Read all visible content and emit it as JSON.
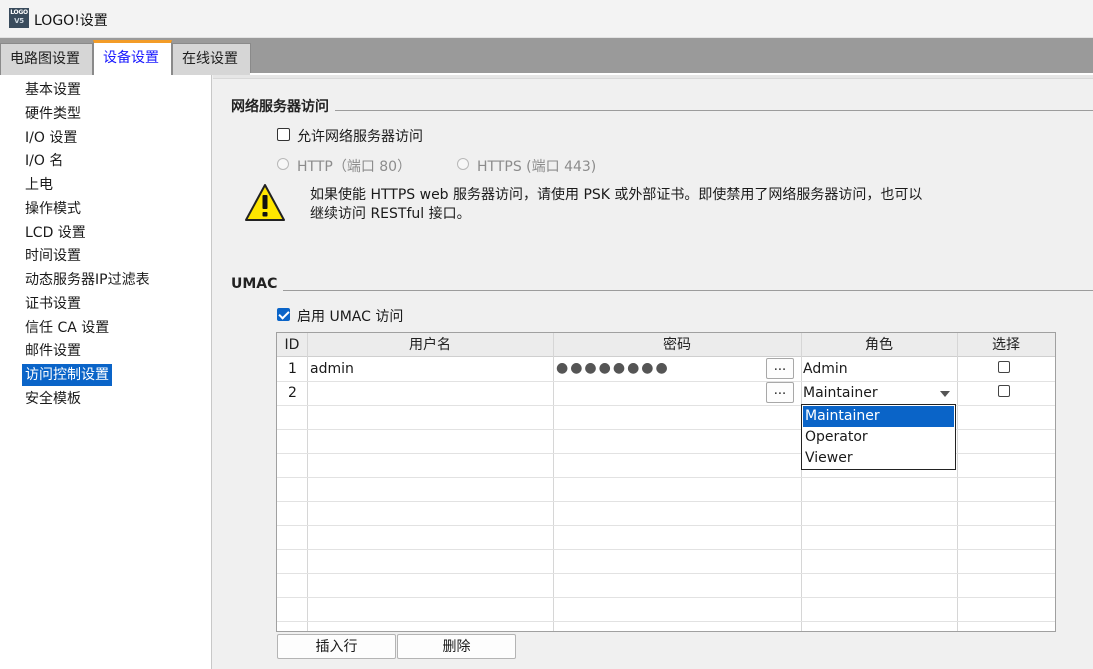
{
  "window": {
    "title": "LOGO!设置",
    "icon_text_top": "LOGO",
    "icon_text_bottom": "V5"
  },
  "tabs": [
    {
      "label": "电路图设置",
      "active": false
    },
    {
      "label": "设备设置",
      "active": true
    },
    {
      "label": "在线设置",
      "active": false
    }
  ],
  "sidebar": {
    "items": [
      {
        "label": "基本设置"
      },
      {
        "label": "硬件类型"
      },
      {
        "label": "I/O 设置"
      },
      {
        "label": "I/O 名"
      },
      {
        "label": "上电"
      },
      {
        "label": "操作模式"
      },
      {
        "label": "LCD 设置"
      },
      {
        "label": "时间设置"
      },
      {
        "label": "动态服务器IP过滤表"
      },
      {
        "label": "证书设置"
      },
      {
        "label": "信任 CA 设置"
      },
      {
        "label": "邮件设置"
      },
      {
        "label": "访问控制设置",
        "selected": true
      },
      {
        "label": "安全模板"
      }
    ]
  },
  "webserver": {
    "section_title": "网络服务器访问",
    "allow_label": "允许网络服务器访问",
    "allow_checked": false,
    "http_label": "HTTP（端口 80）",
    "https_label": "HTTPS (端口 443)",
    "warning_line1": "如果使能 HTTPS web 服务器访问，请使用 PSK 或外部证书。即使禁用了网络服务器访问，也可以",
    "warning_line2": "继续访问 RESTful 接口。",
    "warning_icon": "warning-triangle-icon"
  },
  "umac": {
    "section_title": "UMAC",
    "enable_label": "启用 UMAC 访问",
    "enable_checked": true,
    "columns": [
      "ID",
      "用户名",
      "密码",
      "角色",
      "选择"
    ],
    "rows": [
      {
        "id": "1",
        "username": "admin",
        "password": "●●●●●●●●",
        "browse": "...",
        "role": "Admin",
        "select": false
      },
      {
        "id": "2",
        "username": "",
        "password": "",
        "browse": "...",
        "role": "Maintainer",
        "select": false
      }
    ],
    "role_options": [
      "Maintainer",
      "Operator",
      "Viewer"
    ],
    "selected_role": "Maintainer",
    "insert_button": "插入行",
    "delete_button": "删除"
  },
  "colors": {
    "accent": "#0a64c8",
    "active_tab_border": "#f39c27",
    "active_tab_text": "#1a1aff"
  }
}
